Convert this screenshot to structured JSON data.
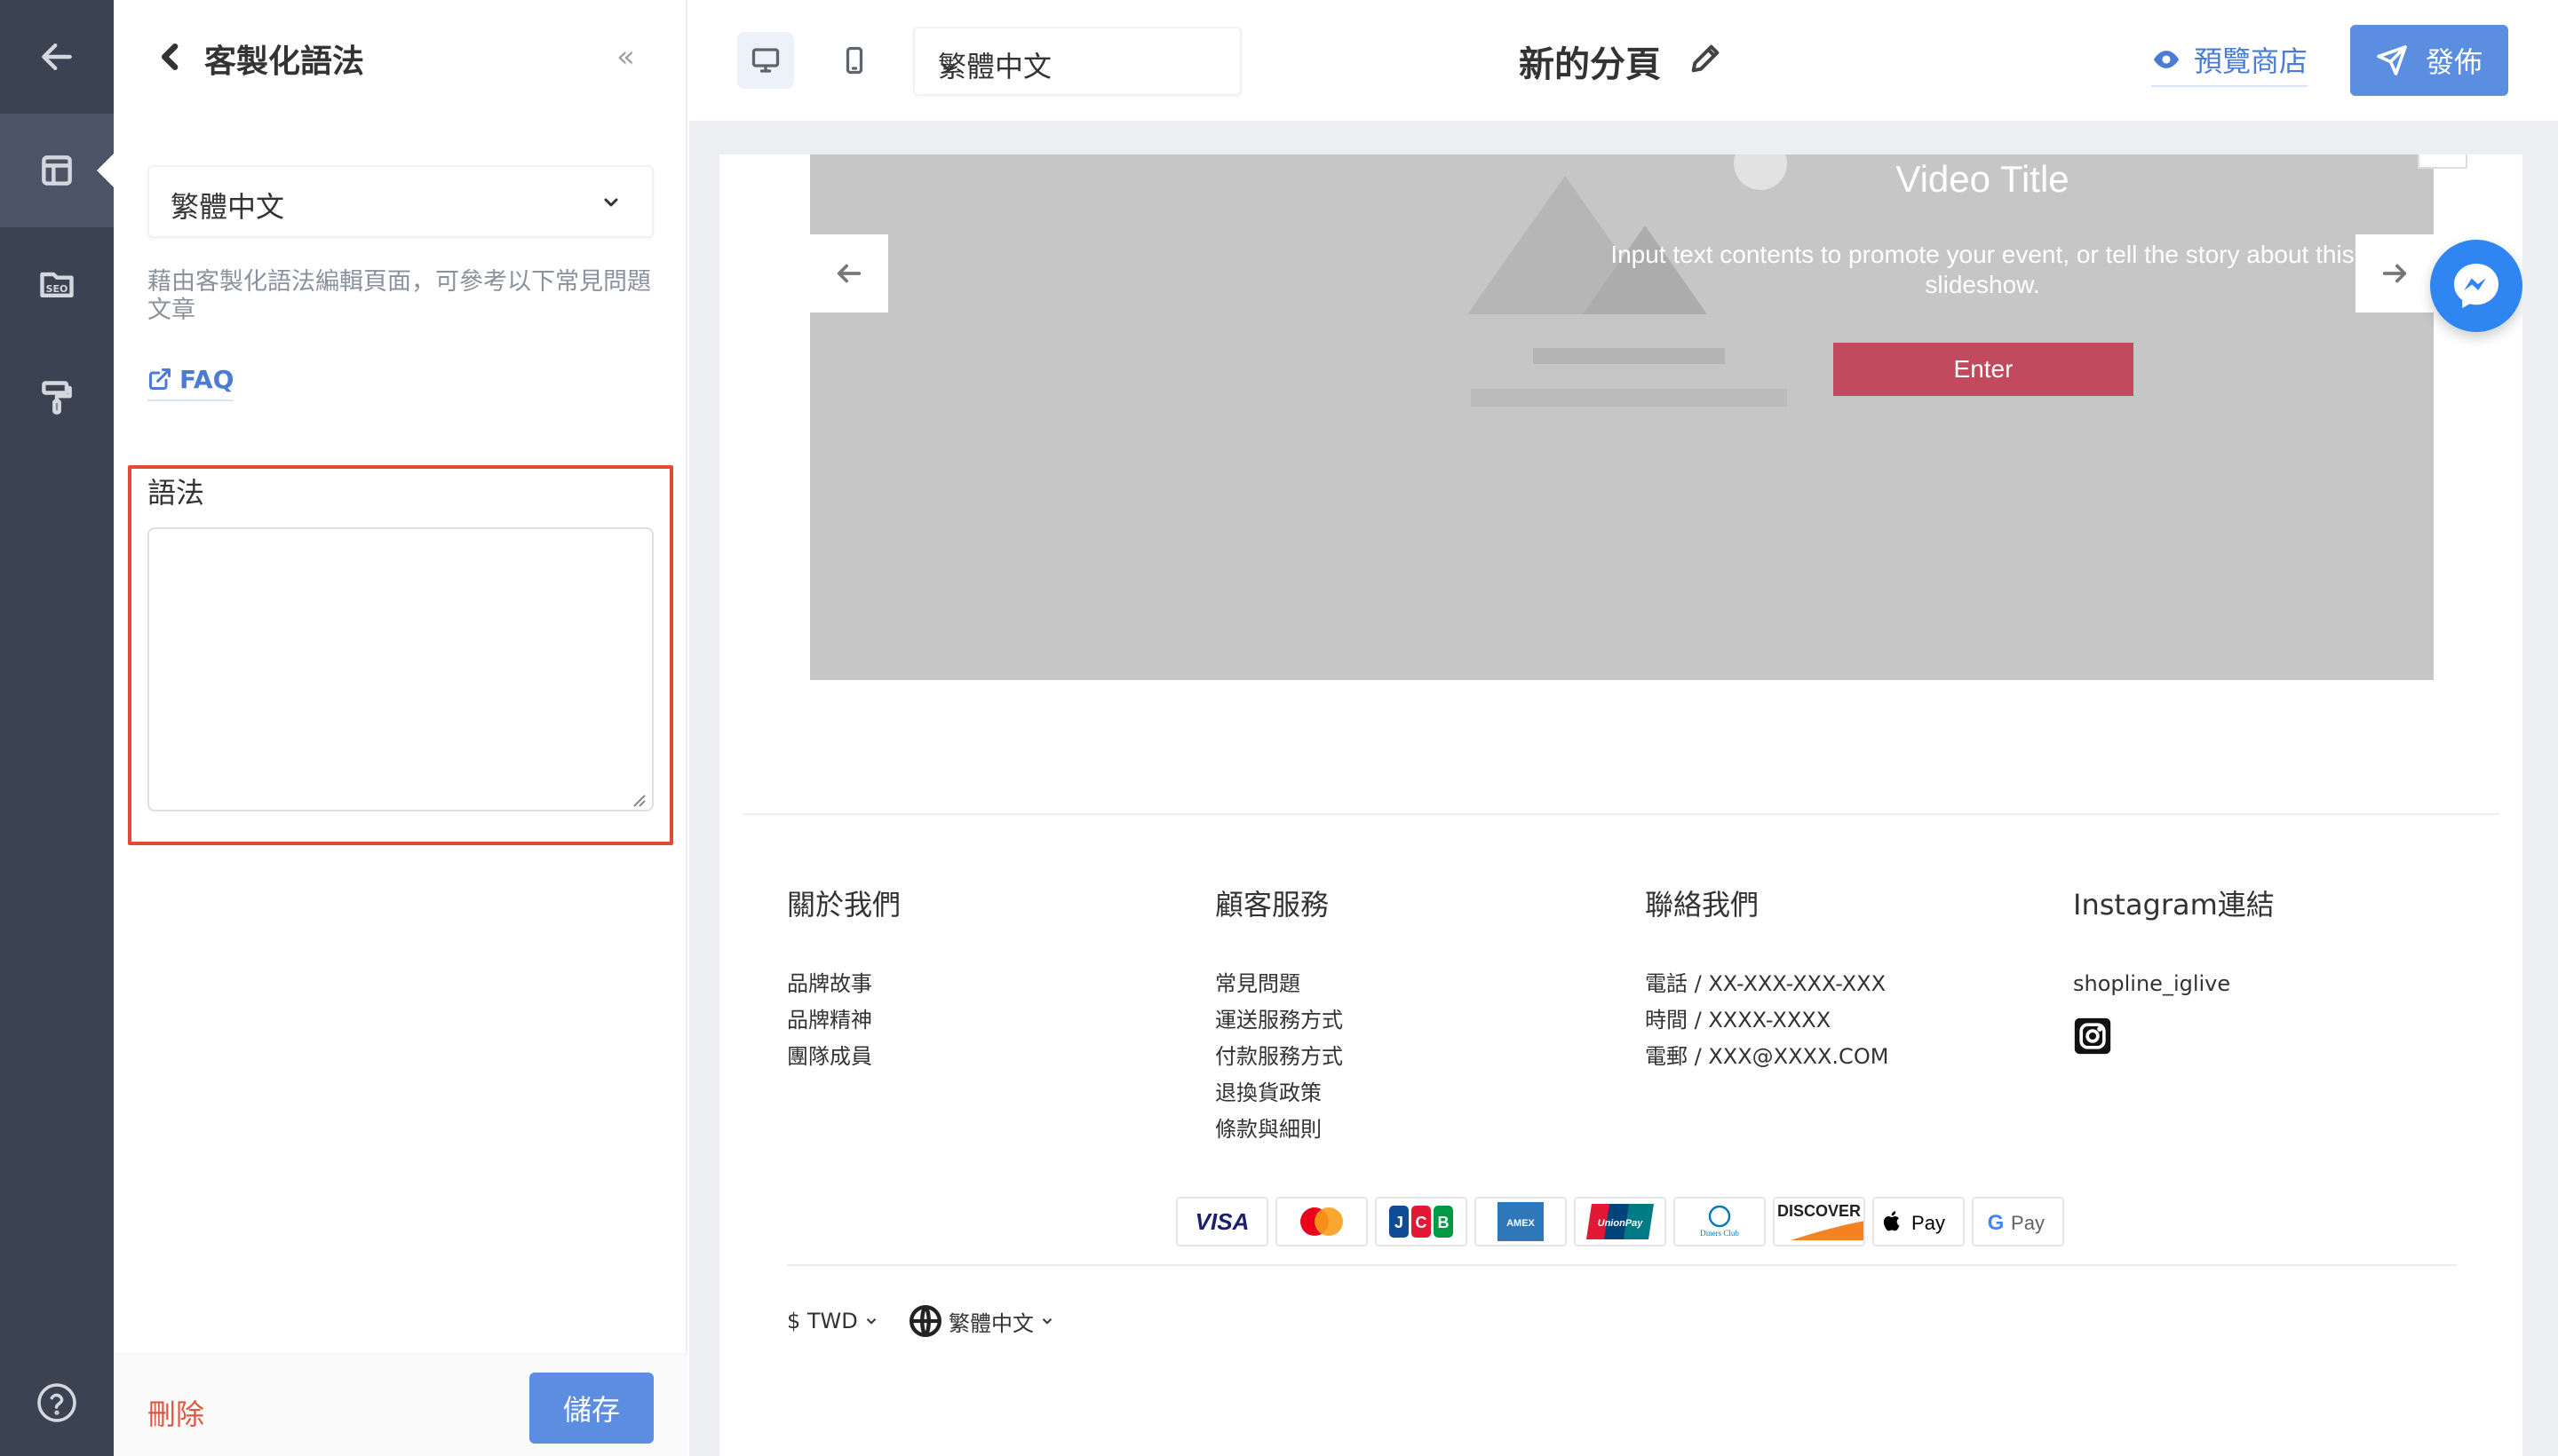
{
  "panel": {
    "title": "客製化語法",
    "language": "繁體中文",
    "help_text": "藉由客製化語法編輯頁面，可參考以下常見問題文章",
    "faq_label": "FAQ",
    "syntax_label": "語法",
    "syntax_value": "",
    "delete_label": "刪除",
    "save_label": "儲存"
  },
  "toolbar": {
    "language": "繁體中文",
    "page_title": "新的分頁",
    "preview_label": "預覽商店",
    "publish_label": "發佈"
  },
  "slideshow": {
    "title": "Video Title",
    "description": "Input text contents to promote your event, or tell the story about this slideshow.",
    "button_label": "Enter"
  },
  "footer": {
    "columns": [
      {
        "heading": "關於我們",
        "items": [
          "品牌故事",
          "品牌精神",
          "團隊成員"
        ]
      },
      {
        "heading": "顧客服務",
        "items": [
          "常見問題",
          "運送服務方式",
          "付款服務方式",
          "退換貨政策",
          "條款與細則"
        ]
      },
      {
        "heading": "聯絡我們",
        "items": [
          "電話 / XX-XXX-XXX-XXX",
          "時間 / XXXX-XXXX",
          "電郵 / XXX@XXXX.COM"
        ]
      },
      {
        "heading": "Instagram連結",
        "items": [
          "shopline_iglive"
        ]
      }
    ],
    "payments": [
      "VISA",
      "Mastercard",
      "JCB",
      "American Express",
      "UnionPay",
      "Diners Club",
      "DISCOVER",
      "Apple Pay",
      "G Pay"
    ],
    "currency": "$ TWD",
    "language": "繁體中文"
  },
  "colors": {
    "accent": "#5b8de0",
    "link": "#4a7bd5",
    "danger": "#e0573f",
    "highlight_border": "#e34a35",
    "enter_button": "#c14a5e",
    "nav_bg": "#3b4252"
  },
  "icons": {
    "nav": [
      "arrow-left-icon",
      "layout-icon",
      "seo-icon",
      "paint-roller-icon",
      "help-icon"
    ],
    "toolbar": [
      "desktop-icon",
      "mobile-icon",
      "pencil-icon",
      "eye-icon",
      "send-icon"
    ]
  }
}
